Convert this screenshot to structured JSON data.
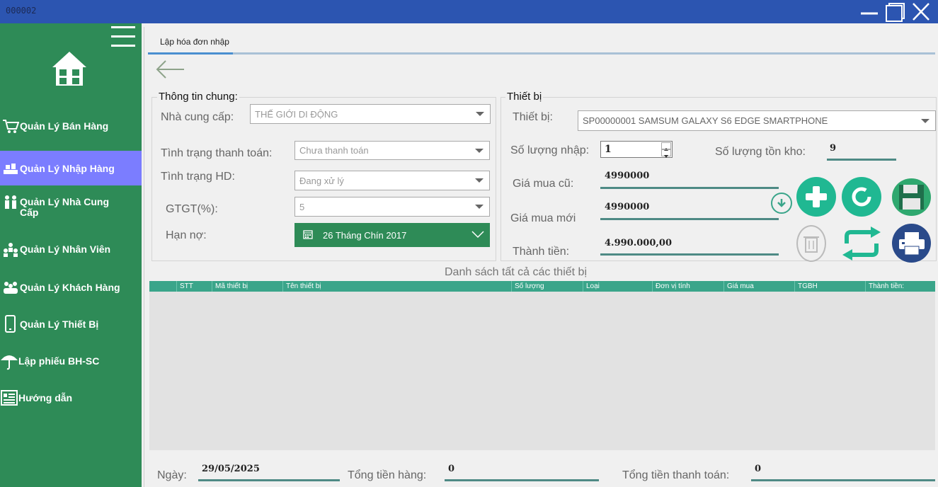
{
  "window": {
    "title": "000002"
  },
  "sidebar": {
    "items": [
      {
        "label": "Quản Lý Bán Hàng",
        "icon": "cart-icon"
      },
      {
        "label": "Quản Lý Nhập Hàng",
        "icon": "import-goods-icon"
      },
      {
        "label": "Quản Lý Nhà Cung Cấp",
        "icon": "supplier-icon"
      },
      {
        "label": "Quản Lý Nhân Viên",
        "icon": "employees-icon"
      },
      {
        "label": "Quản Lý Khách Hàng",
        "icon": "customers-icon"
      },
      {
        "label": "Quản Lý Thiết Bị",
        "icon": "phone-icon"
      },
      {
        "label": "Lập phiếu BH-SC",
        "icon": "umbrella-icon"
      },
      {
        "label": "Hướng dẫn",
        "icon": "guide-icon"
      }
    ],
    "active_index": 1
  },
  "tab": {
    "label": "Lập hóa đơn nhập"
  },
  "general": {
    "title": "Thông tin chung:",
    "supplier_label": "Nhà cung cấp:",
    "supplier_value": "THẾ GIỚI DI ĐỘNG",
    "payment_status_label": "Tình trạng thanh toán:",
    "payment_status_value": "Chưa thanh toán",
    "invoice_status_label": "Tình trạng HD:",
    "invoice_status_value": "Đang xử lý",
    "vat_label": "GTGT(%):",
    "vat_value": "5",
    "due_label": "Hạn nợ:",
    "due_value": "26 Tháng Chín 2017"
  },
  "device": {
    "title": "Thiết bị",
    "device_label": "Thiết bị:",
    "device_value": "SP00000001  SAMSUM GALAXY S6 EDGE  SMARTPHONE",
    "qty_label": "Số lượng nhập:",
    "qty_value": "1",
    "stock_label": "Số lượng tồn kho:",
    "stock_value": "9",
    "old_price_label": "Giá mua cũ:",
    "old_price_value": "4990000",
    "new_price_label": "Giá mua mới",
    "new_price_value": "4990000",
    "total_label": "Thành tiền:",
    "total_value": "4.990.000,00"
  },
  "table": {
    "title": "Danh sách tất cả các thiết bị",
    "columns": [
      "STT",
      "Mã thiết bị",
      "Tên thiết bị",
      "Số lượng",
      "Loại",
      "Đơn vị tính",
      "Giá mua",
      "TGBH",
      "Thành tiền:"
    ]
  },
  "footer": {
    "date_label": "Ngày:",
    "date_value": "29/05/2025",
    "goods_total_label": "Tổng tiền hàng:",
    "goods_total_value": "0",
    "pay_total_label": "Tổng tiền thanh toán:",
    "pay_total_value": "0"
  },
  "colors": {
    "titlebar": "#2c55b1",
    "sidebar": "#2e8b57",
    "sidebar_active": "#7b7dff",
    "accent": "#3aa58a",
    "underline": "#4e8a85",
    "date_picker": "#2e8b57"
  }
}
